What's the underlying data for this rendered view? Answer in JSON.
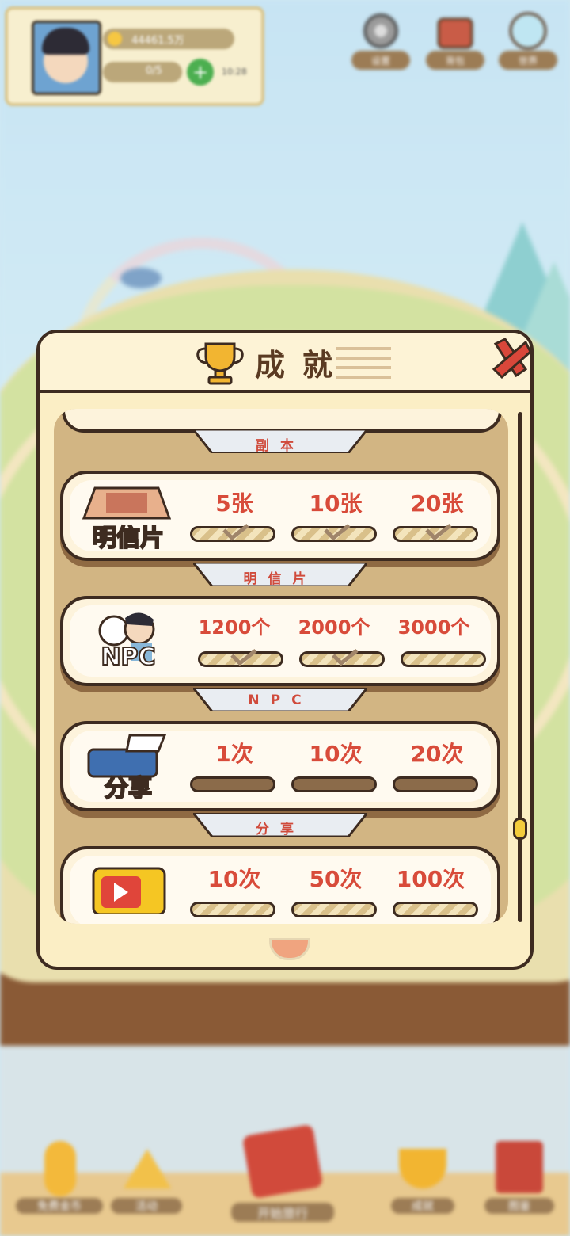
{
  "hud": {
    "coins": "44461.5万",
    "energy": "0/5",
    "timer": "10:28",
    "buttons": [
      "设置",
      "背包",
      "世界"
    ]
  },
  "modal": {
    "title": "成就",
    "sections": [
      {
        "label": "副本"
      },
      {
        "label": "明信片",
        "name": "明信片",
        "icon": "postcard-icon",
        "goals": [
          {
            "text": "5张",
            "done": true
          },
          {
            "text": "10张",
            "done": true
          },
          {
            "text": "20张",
            "done": true
          }
        ]
      },
      {
        "label": "NPC",
        "name": "NPC",
        "icon": "npc-icon",
        "goals": [
          {
            "text": "1200个",
            "done": true
          },
          {
            "text": "2000个",
            "done": true
          },
          {
            "text": "3000个",
            "done": false
          }
        ]
      },
      {
        "label": "分享",
        "name": "分享",
        "icon": "printer-icon",
        "goals": [
          {
            "text": "1次",
            "done": false
          },
          {
            "text": "10次",
            "done": false
          },
          {
            "text": "20次",
            "done": false
          }
        ]
      },
      {
        "label": "",
        "name": "",
        "icon": "tv-icon",
        "goals": [
          {
            "text": "10次",
            "done": true
          },
          {
            "text": "50次",
            "done": true
          },
          {
            "text": "100次",
            "done": true
          }
        ]
      }
    ]
  },
  "nav": [
    "免费金币",
    "活动",
    "开始旅行",
    "成就",
    "图鉴"
  ],
  "colors": {
    "accent_red": "#d84b3a",
    "frame": "#3d2b20",
    "panel": "#fbeec5"
  }
}
